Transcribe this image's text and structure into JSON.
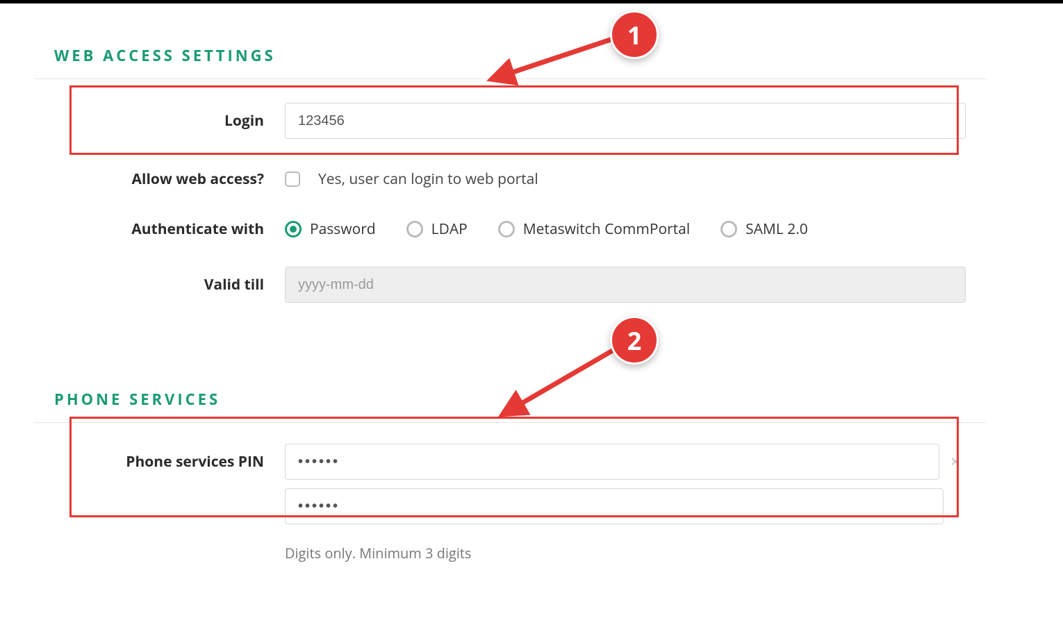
{
  "sections": {
    "web_access": {
      "title": "WEB  ACCESS  SETTINGS",
      "login_label": "Login",
      "login_value": "123456",
      "allow_label": "Allow web access?",
      "allow_checkbox_text": "Yes, user can login to web portal",
      "allow_checked": false,
      "auth_label": "Authenticate with",
      "auth_options": {
        "password": "Password",
        "ldap": "LDAP",
        "metaswitch": "Metaswitch CommPortal",
        "saml": "SAML 2.0"
      },
      "auth_selected": "password",
      "valid_till_label": "Valid till",
      "valid_till_placeholder": "yyyy-mm-dd",
      "valid_till_value": ""
    },
    "phone_services": {
      "title": "PHONE  SERVICES",
      "pin_label": "Phone services PIN",
      "pin_value": "••••••",
      "pin_confirm_value": "••••••",
      "pin_hint": "Digits only. Minimum 3 digits"
    }
  },
  "annotations": {
    "callout1": "1",
    "callout2": "2"
  },
  "colors": {
    "accent": "#1a9b74",
    "annotation": "#e53935"
  }
}
